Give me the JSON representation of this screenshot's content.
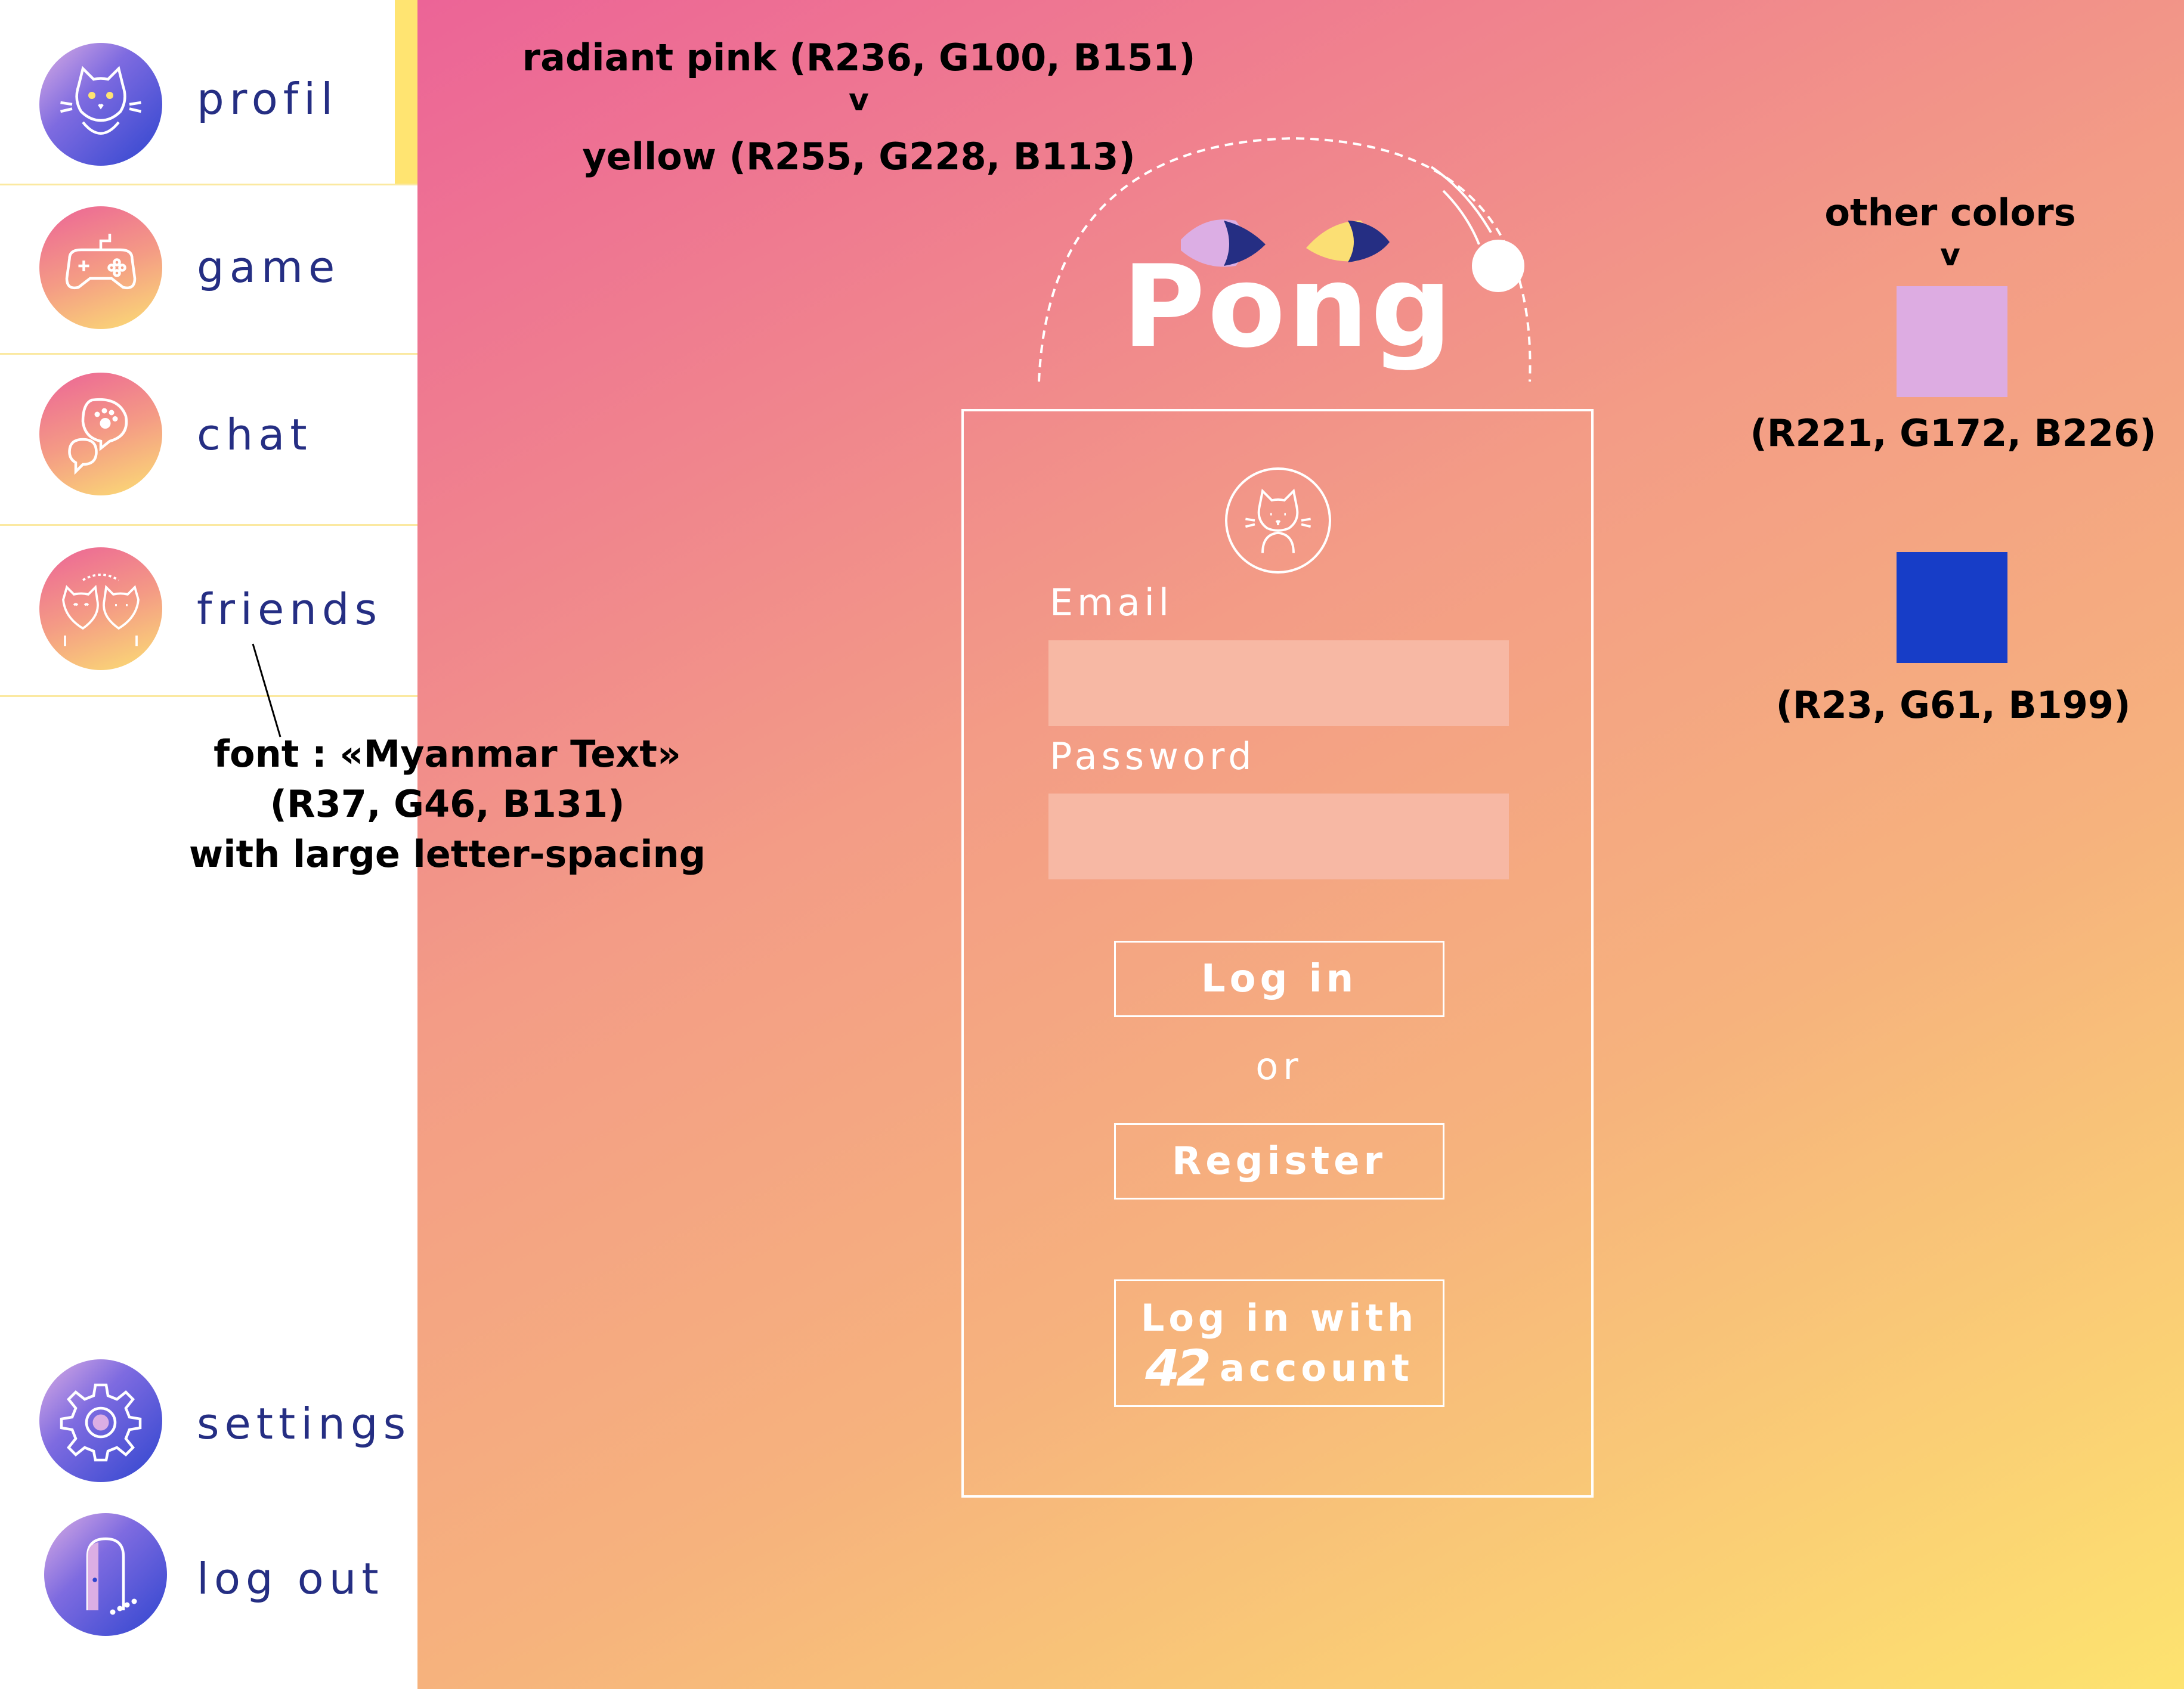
{
  "sidebar": {
    "items": [
      {
        "label": "profil",
        "icon": "cat-portrait-icon",
        "active": true
      },
      {
        "label": "game",
        "icon": "gamepad-icon"
      },
      {
        "label": "chat",
        "icon": "chat-bubbles-icon"
      },
      {
        "label": "friends",
        "icon": "two-cats-icon"
      },
      {
        "label": "settings",
        "icon": "gear-icon"
      },
      {
        "label": "log out",
        "icon": "door-icon"
      }
    ]
  },
  "header": {
    "title": "Pong"
  },
  "login": {
    "email_label": "Email",
    "email_value": "",
    "password_label": "Password",
    "password_value": "",
    "login_button": "Log in",
    "or_text": "or",
    "register_button": "Register",
    "login42_line1": "Log in with",
    "login42_logo": "42",
    "login42_line2": "account"
  },
  "annotations": {
    "primary_line1": "radiant pink (R236, G100, B151)",
    "primary_arrow": "v",
    "primary_line2": "yellow (R255, G228, B113)",
    "other_title": "other colors",
    "other_arrow": "v",
    "swatch1_label": "(R221, G172, B226)",
    "swatch2_label": "(R23, G61, B199)",
    "font_line1": "font : «Myanmar Text»",
    "font_line2": "(R37, G46, B131)",
    "font_line3": "with large letter-spacing"
  },
  "colors": {
    "pink": "#ec6497",
    "yellow": "#ffe471",
    "lavender": "#ddace2",
    "blue": "#173dc7",
    "navy_text": "#252e83"
  }
}
